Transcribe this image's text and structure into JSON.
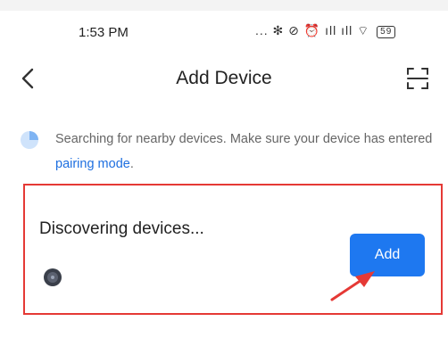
{
  "status_bar": {
    "time": "1:53 PM",
    "icons_text": "... ✻ ⊘ ⏰ ıll ıll ⌔",
    "battery": "59",
    "icon_names": [
      "more-icon",
      "bluetooth-icon",
      "mute-icon",
      "alarm-icon",
      "signal-icon",
      "signal-icon",
      "wifi-icon",
      "battery-icon"
    ]
  },
  "header": {
    "title": "Add Device",
    "back_icon": "back-chevron-icon",
    "scan_icon": "scan-icon"
  },
  "notice": {
    "text": "Searching for nearby devices. Make sure your device has entered ",
    "link": "pairing mode",
    "suffix": ".",
    "icon": "searching-spinner-icon"
  },
  "discovery": {
    "title": "Discovering devices...",
    "add_label": "Add",
    "device_icon": "device-icon"
  },
  "colors": {
    "accent": "#1e78f0",
    "link": "#1e6fe0",
    "highlight_border": "#e53935",
    "pointer_arrow": "#e53935"
  }
}
